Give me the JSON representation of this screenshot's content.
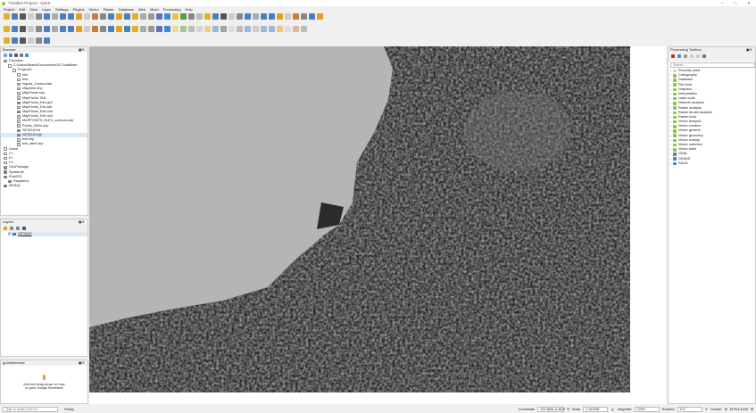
{
  "window": {
    "title": "*Untitled Project - QGIS"
  },
  "menu": [
    "Project",
    "Edit",
    "View",
    "Layer",
    "Settings",
    "Plugins",
    "Vector",
    "Raster",
    "Database",
    "Web",
    "Mesh",
    "Processing",
    "Help"
  ],
  "browser": {
    "title": "Browser",
    "items": [
      {
        "label": "Favorites",
        "level": 0,
        "icon": "star-icon"
      },
      {
        "label": "C:\\Users\\dhanli\\Documents\\GIS DataBase",
        "level": 1,
        "icon": "folder-icon"
      },
      {
        "label": "Project01",
        "level": 2,
        "icon": "folder-icon"
      },
      {
        "label": "info",
        "level": 3,
        "icon": "folder-icon"
      },
      {
        "label": "test",
        "level": 3,
        "icon": "folder-icon"
      },
      {
        "label": "Ingusa_Contour.tab",
        "level": 3,
        "icon": "vector-icon"
      },
      {
        "label": "MapArea.shp",
        "level": 3,
        "icon": "vector-icon"
      },
      {
        "label": "MapPoints.shp",
        "level": 3,
        "icon": "vector-icon"
      },
      {
        "label": "MapPoints.TAB",
        "level": 3,
        "icon": "vector-icon"
      },
      {
        "label": "MapPoints_Elev.grd",
        "level": 3,
        "icon": "raster-icon"
      },
      {
        "label": "MapPoints_Elev.tab",
        "level": 3,
        "icon": "vector-icon"
      },
      {
        "label": "MapPoints_Elev.xml",
        "level": 3,
        "icon": "raster-icon"
      },
      {
        "label": "MapPoints_Elev.xml",
        "level": 3,
        "icon": "vector-icon"
      },
      {
        "label": "MAPPOINTS_ELEV_contours.tab",
        "level": 3,
        "icon": "vector-icon"
      },
      {
        "label": "Points_500m.shp",
        "level": 3,
        "icon": "vector-icon"
      },
      {
        "label": "SE78110.bil",
        "level": 3,
        "icon": "raster-icon"
      },
      {
        "label": "SE78110.bgl",
        "level": 3,
        "icon": "raster-icon",
        "selected": true
      },
      {
        "label": "test.shp",
        "level": 3,
        "icon": "vector-icon"
      },
      {
        "label": "test_label.shp",
        "level": 3,
        "icon": "vector-icon"
      },
      {
        "label": "Home",
        "level": 0,
        "icon": "folder-icon"
      },
      {
        "label": "C:\\",
        "level": 0,
        "icon": "drive-icon"
      },
      {
        "label": "E:\\",
        "level": 0,
        "icon": "drive-icon"
      },
      {
        "label": "H:\\",
        "level": 0,
        "icon": "drive-icon"
      },
      {
        "label": "GeoPackage",
        "level": 0,
        "icon": "geopackage-icon"
      },
      {
        "label": "SpatiaLite",
        "level": 0,
        "icon": "spatialite-icon"
      },
      {
        "label": "PostGIS",
        "level": 0,
        "icon": "postgis-icon"
      },
      {
        "label": "Raspberry",
        "level": 1,
        "icon": "connection-icon"
      },
      {
        "label": "MSSQL",
        "level": 0,
        "icon": "mssql-icon"
      }
    ]
  },
  "layers": {
    "title": "Layers",
    "items": [
      {
        "label": "SE78110",
        "checked": true
      }
    ]
  },
  "streetview": {
    "title": "go2streetview",
    "line1": "click and drag cursor on map",
    "line2": "to open Google Streetview"
  },
  "toolbox": {
    "title": "Processing Toolbox",
    "search_placeholder": "Search...",
    "items": [
      "Recently used",
      "Cartography",
      "Database",
      "File tools",
      "Graphics",
      "Interpolation",
      "Layer tools",
      "Network analysis",
      "Raster analysis",
      "Raster terrain analysis",
      "Raster tools",
      "Vector analysis",
      "Vector creation",
      "Vector general",
      "Vector geometry",
      "Vector overlay",
      "Vector selection",
      "Vector table",
      "GDAL",
      "GRASS",
      "SAGA"
    ]
  },
  "status": {
    "locate_placeholder": "Type to locate (Ctrl+K)",
    "ready": "Ready",
    "coordinate_label": "Coordinate",
    "coordinate": "131.4806,-6.4647",
    "scale_label": "Scale",
    "scale": "1:167948",
    "magnifier_label": "Magnifier",
    "magnifier": "100%",
    "rotation_label": "Rotation",
    "rotation": "0.0 °",
    "render_label": "Render",
    "crs": "EPSG:4326"
  },
  "colors": {
    "sea": "#b5b5b5",
    "land": "#2a2a2a",
    "qgis_green": "#8bc34a"
  }
}
